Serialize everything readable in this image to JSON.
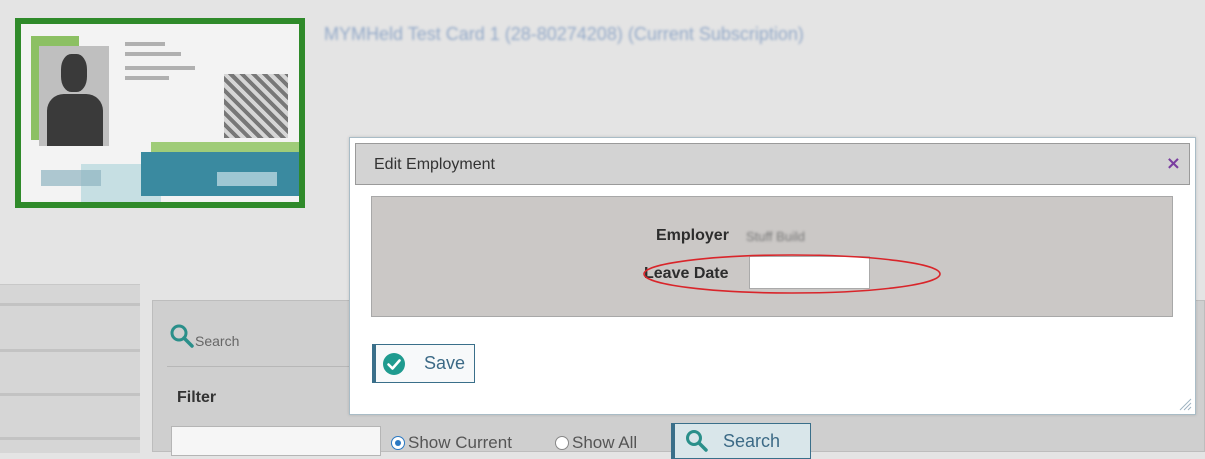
{
  "card": {
    "title": "MYMHeld Test Card 1 (28-80274208) (Current Subscription)",
    "icon": "id-card-image"
  },
  "dialog": {
    "title": "Edit Employment",
    "close_label": "×",
    "employer_label": "Employer",
    "employer_value": "Stuff Build",
    "leave_date_label": "Leave Date",
    "leave_date_value": "",
    "save_label": "Save"
  },
  "search": {
    "heading": "Search",
    "filter_label": "Filter",
    "filter_value": "",
    "radio_current": "Show Current",
    "radio_all": "Show All",
    "selected": "Show Current",
    "button_label": "Search"
  },
  "colors": {
    "accent": "#3a6f8a",
    "close": "#7a3ea0",
    "highlight": "#d9252a",
    "card_border": "#2f8a2a"
  }
}
